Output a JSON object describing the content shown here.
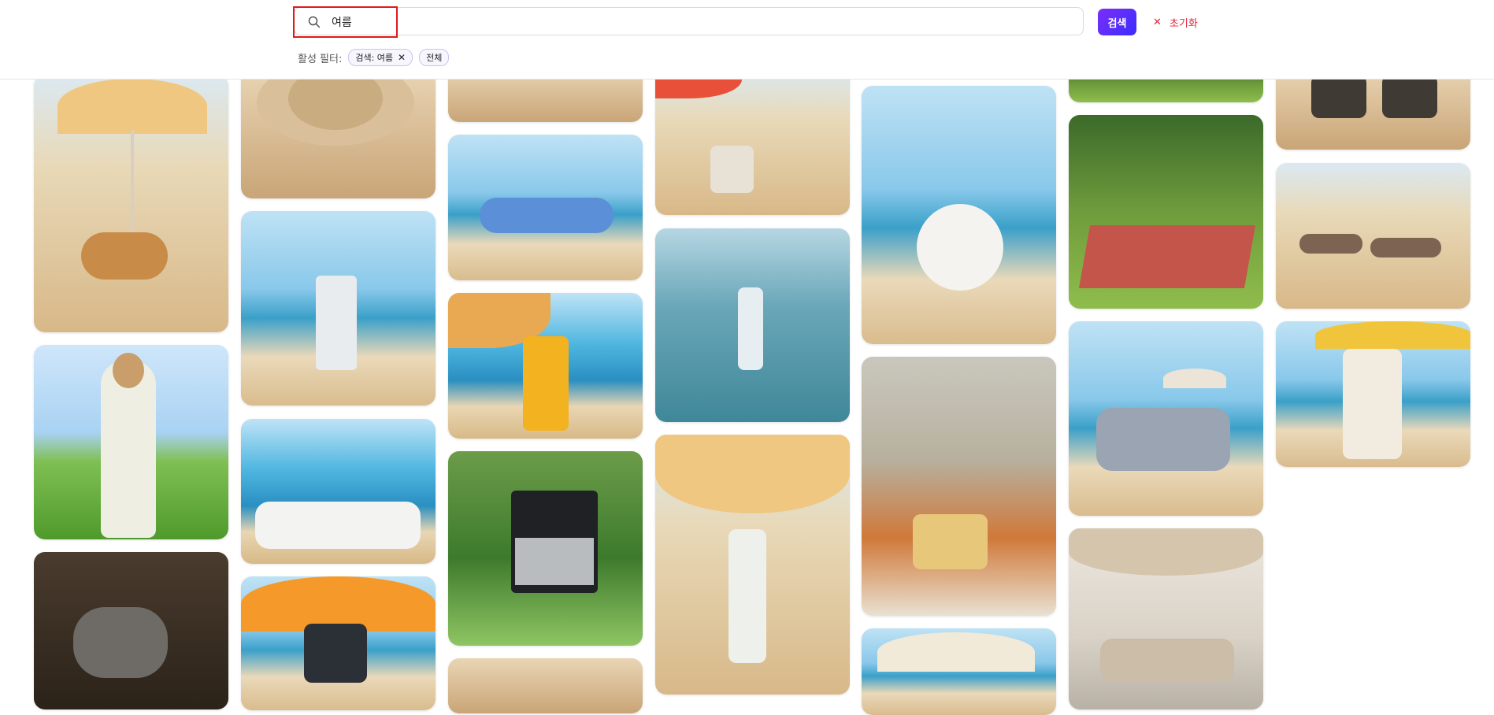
{
  "search": {
    "value": "여름",
    "button_label": "검색",
    "reset_label": "초기화"
  },
  "filters": {
    "label": "활성 필터:",
    "chips": [
      {
        "label": "검색: 여름",
        "removable": true
      },
      {
        "label": "전체",
        "removable": false
      }
    ]
  },
  "colors": {
    "accent_gradient_start": "#7b2ff7",
    "accent_gradient_end": "#3b2cff",
    "reset": "#e0243a",
    "highlight_box": "#e11919"
  },
  "gallery": {
    "cards": [
      {
        "subject": "sandal-under-beach-umbrella"
      },
      {
        "subject": "woman-in-white-dress-meadow"
      },
      {
        "subject": "sneaker-on-ground"
      },
      {
        "subject": "straw-hat-on-sand"
      },
      {
        "subject": "can-on-beach"
      },
      {
        "subject": "white-sofa-by-sea"
      },
      {
        "subject": "action-camera-under-umbrella"
      },
      {
        "subject": "sand"
      },
      {
        "subject": "swim-goggles"
      },
      {
        "subject": "drink-can-on-beach"
      },
      {
        "subject": "barbecue-grill-garden"
      },
      {
        "subject": "bag-on-sand"
      },
      {
        "subject": "mug-on-beach"
      },
      {
        "subject": "water-bottle-in-sea"
      },
      {
        "subject": "sunscreen-bottle-beach"
      },
      {
        "subject": "baseball-on-sand"
      },
      {
        "subject": "cream-jar-autumn"
      },
      {
        "subject": "beach-umbrella-chair"
      },
      {
        "subject": "green-foliage"
      },
      {
        "subject": "picnic-blanket-forest"
      },
      {
        "subject": "suv-on-beach"
      },
      {
        "subject": "sofa-under-umbrella"
      },
      {
        "subject": "boots-on-sand"
      },
      {
        "subject": "flip-flops-shore"
      },
      {
        "subject": "clothes-under-umbrella"
      }
    ]
  }
}
